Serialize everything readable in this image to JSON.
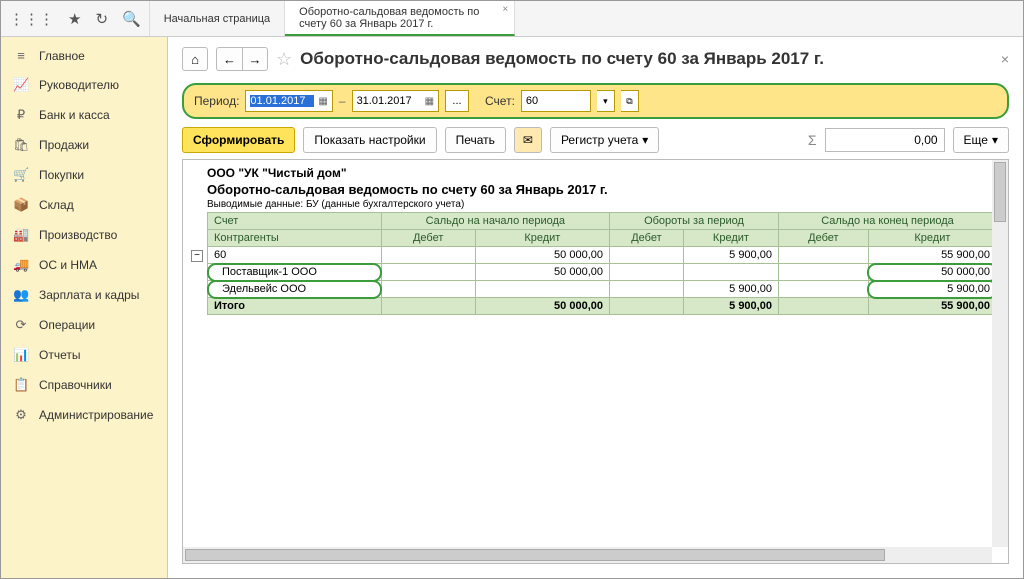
{
  "topbar": {
    "apps_icon": "⋮⋮⋮",
    "star_icon": "★",
    "history_icon": "↻",
    "search_icon": "🔍"
  },
  "tabs": [
    {
      "label": "Начальная страница"
    },
    {
      "label": "Оборотно-сальдовая ведомость по счету 60 за Январь 2017 г.",
      "active": true
    }
  ],
  "sidebar": [
    {
      "icon": "≡",
      "label": "Главное"
    },
    {
      "icon": "📈",
      "label": "Руководителю"
    },
    {
      "icon": "₽",
      "label": "Банк и касса"
    },
    {
      "icon": "🛍",
      "label": "Продажи"
    },
    {
      "icon": "🛒",
      "label": "Покупки"
    },
    {
      "icon": "📦",
      "label": "Склад"
    },
    {
      "icon": "🏭",
      "label": "Производство"
    },
    {
      "icon": "🚚",
      "label": "ОС и НМА"
    },
    {
      "icon": "👥",
      "label": "Зарплата и кадры"
    },
    {
      "icon": "⟳",
      "label": "Операции"
    },
    {
      "icon": "📊",
      "label": "Отчеты"
    },
    {
      "icon": "📋",
      "label": "Справочники"
    },
    {
      "icon": "⚙",
      "label": "Администрирование"
    }
  ],
  "page": {
    "home_icon": "⌂",
    "back_icon": "←",
    "fwd_icon": "→",
    "star_icon": "☆",
    "title": "Оборотно-сальдовая ведомость по счету 60 за Январь 2017 г.",
    "close_icon": "×"
  },
  "period": {
    "label": "Период:",
    "from": "01.01.2017",
    "to": "31.01.2017",
    "dash": "–",
    "dots": "...",
    "account_label": "Счет:",
    "account": "60",
    "dd": "▾",
    "open": "⧉"
  },
  "toolbar": {
    "form": "Сформировать",
    "settings": "Показать настройки",
    "print": "Печать",
    "mail_icon": "✉",
    "register": "Регистр учета",
    "dd": "▾",
    "sum_icon": "Σ",
    "sum_value": "0,00",
    "more": "Еще",
    "more_dd": "▾"
  },
  "report": {
    "org": "ООО \"УК \"Чистый дом\"",
    "title": "Оборотно-сальдовая ведомость по счету 60 за Январь 2017 г.",
    "sub": "Выводимые данные: БУ (данные бухгалтерского учета)",
    "toggle": "−",
    "headers": {
      "account": "Счет",
      "contr": "Контрагенты",
      "start": "Сальдо на начало периода",
      "turn": "Обороты за период",
      "end": "Сальдо на конец периода",
      "debit": "Дебет",
      "credit": "Кредит"
    },
    "rows": [
      {
        "label": "60",
        "start_d": "",
        "start_c": "50 000,00",
        "turn_d": "",
        "turn_c": "5 900,00",
        "end_d": "",
        "end_c": "55 900,00"
      },
      {
        "label": "Поставщик-1 ООО",
        "start_d": "",
        "start_c": "50 000,00",
        "turn_d": "",
        "turn_c": "",
        "end_d": "",
        "end_c": "50 000,00",
        "hl_label": true,
        "hl_end": true
      },
      {
        "label": "Эдельвейс ООО",
        "start_d": "",
        "start_c": "",
        "turn_d": "",
        "turn_c": "5 900,00",
        "end_d": "",
        "end_c": "5 900,00",
        "hl_label": true,
        "hl_end": true
      }
    ],
    "total": {
      "label": "Итого",
      "start_d": "",
      "start_c": "50 000,00",
      "turn_d": "",
      "turn_c": "5 900,00",
      "end_d": "",
      "end_c": "55 900,00"
    }
  },
  "chart_data": {
    "type": "table",
    "title": "Оборотно-сальдовая ведомость по счету 60 за Январь 2017 г.",
    "columns": [
      "Счет/Контрагенты",
      "Сальдо на начало Дебет",
      "Сальдо на начало Кредит",
      "Обороты Дебет",
      "Обороты Кредит",
      "Сальдо на конец Дебет",
      "Сальдо на конец Кредит"
    ],
    "rows": [
      [
        "60",
        null,
        50000.0,
        null,
        5900.0,
        null,
        55900.0
      ],
      [
        "Поставщик-1 ООО",
        null,
        50000.0,
        null,
        null,
        null,
        50000.0
      ],
      [
        "Эдельвейс ООО",
        null,
        null,
        null,
        5900.0,
        null,
        5900.0
      ],
      [
        "Итого",
        null,
        50000.0,
        null,
        5900.0,
        null,
        55900.0
      ]
    ]
  }
}
